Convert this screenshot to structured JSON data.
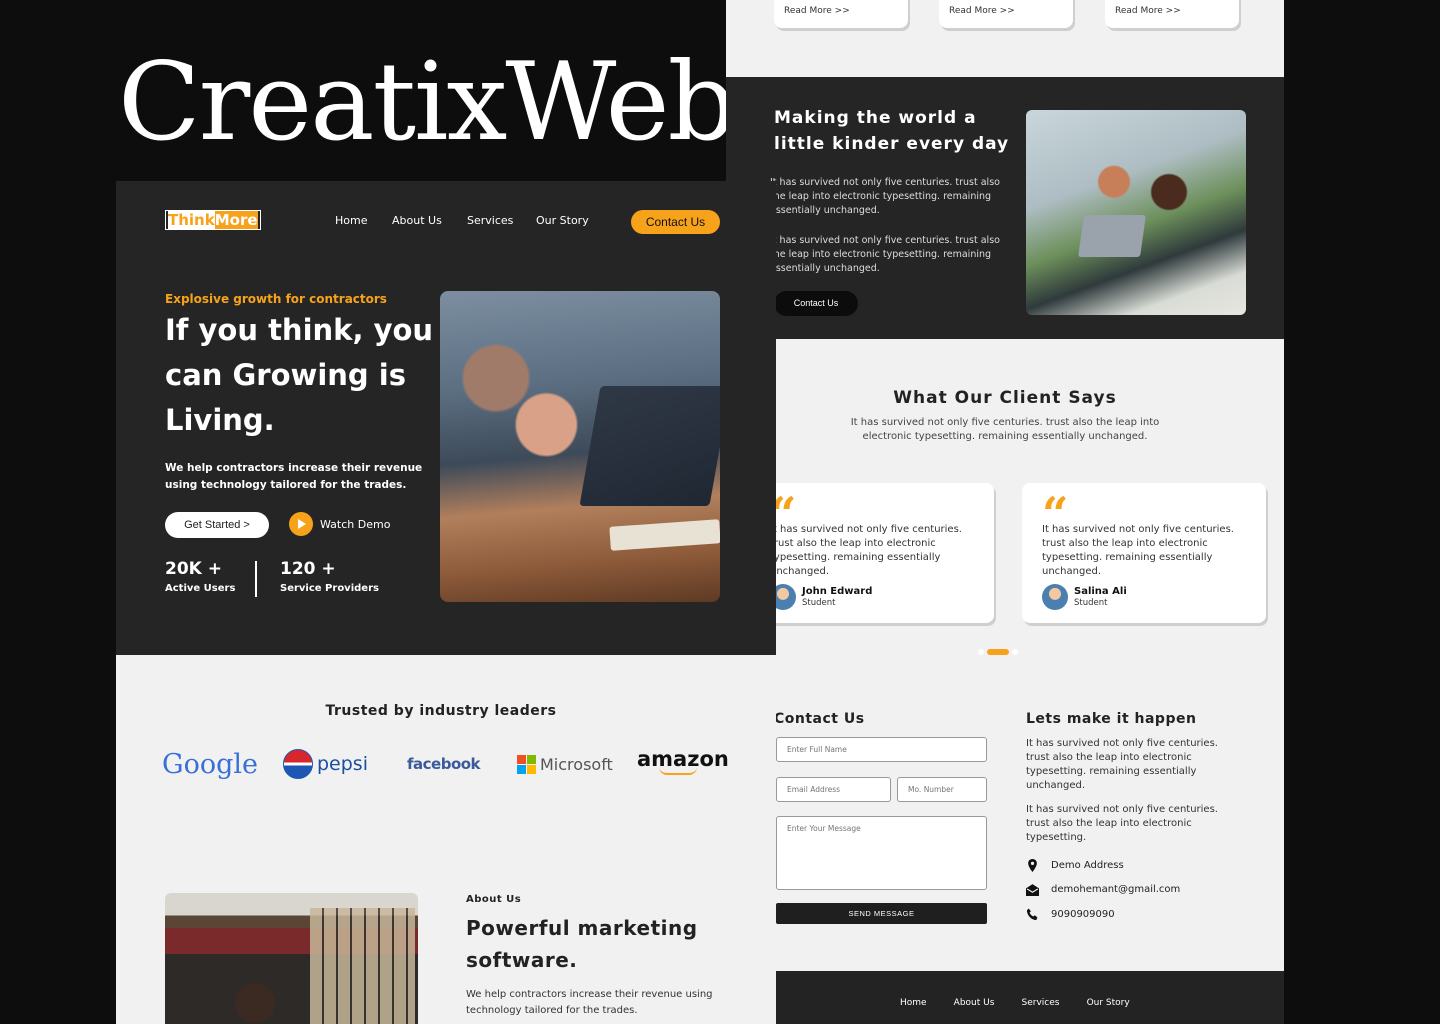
{
  "brand": "CreatixWeb",
  "page1": {
    "logo": {
      "part1": "Think",
      "part2": "More"
    },
    "nav": [
      "Home",
      "About Us",
      "Services",
      "Our Story"
    ],
    "contact_button": "Contact Us",
    "hero": {
      "eyebrow": "Explosive growth for contractors",
      "headline": "If you think, you can Growing is Living.",
      "lead": "We help contractors increase their revenue using technology tailored for the trades.",
      "cta_primary": "Get Started >",
      "cta_secondary": "Watch Demo",
      "stats": [
        {
          "value": "20K +",
          "label": "Active Users"
        },
        {
          "value": "120 +",
          "label": "Service Providers"
        }
      ]
    },
    "trusted": {
      "title": "Trusted by industry leaders",
      "logos": [
        "Google",
        "pepsi",
        "facebook",
        "Microsoft",
        "amazon"
      ]
    },
    "about": {
      "eyebrow": "About Us",
      "title": "Powerful marketing software.",
      "text": "We help contractors increase their revenue using technology tailored for the trades."
    }
  },
  "page2": {
    "read_more": [
      "Read More >>",
      "Read More >>",
      "Read More >>"
    ],
    "mission": {
      "title": "Making the world a little kinder every day",
      "para1": "It has survived not only five centuries. trust also the leap into electronic typesetting. remaining essentially unchanged.",
      "para2": "It has survived not only five centuries. trust also the leap into electronic typesetting. remaining essentially unchanged.",
      "button": "Contact Us"
    },
    "testimonials": {
      "title": "What Our Client Says",
      "subtitle": "It has survived not only five centuries. trust also the leap into electronic typesetting. remaining essentially unchanged.",
      "items": [
        {
          "text": "It has survived not only five centuries. trust also the leap into electronic typesetting. remaining essentially unchanged.",
          "name": "John Edward",
          "role": "Student"
        },
        {
          "text": "It has survived not only five centuries. trust also the leap into electronic typesetting. remaining essentially unchanged.",
          "name": "Salina Ali",
          "role": "Student"
        }
      ]
    },
    "contact": {
      "title": "Contact Us",
      "name_placeholder": "Enter Full Name",
      "email_placeholder": "Email Address",
      "phone_placeholder": "Mo. Number",
      "message_placeholder": "Enter Your Message",
      "send": "SEND MESSAGE"
    },
    "happen": {
      "title": "Lets make it happen",
      "para1": "It has survived not only five centuries. trust also the leap into electronic typesetting. remaining essentially unchanged.",
      "para2": "It has survived not only five centuries. trust also the leap into electronic typesetting.",
      "address": "Demo Address",
      "email": "demohemant@gmail.com",
      "phone": "9090909090"
    },
    "footer_nav": [
      "Home",
      "About Us",
      "Services",
      "Our Story"
    ]
  },
  "colors": {
    "accent": "#f7a21b",
    "dark": "#252525",
    "light": "#f1f1f1"
  }
}
